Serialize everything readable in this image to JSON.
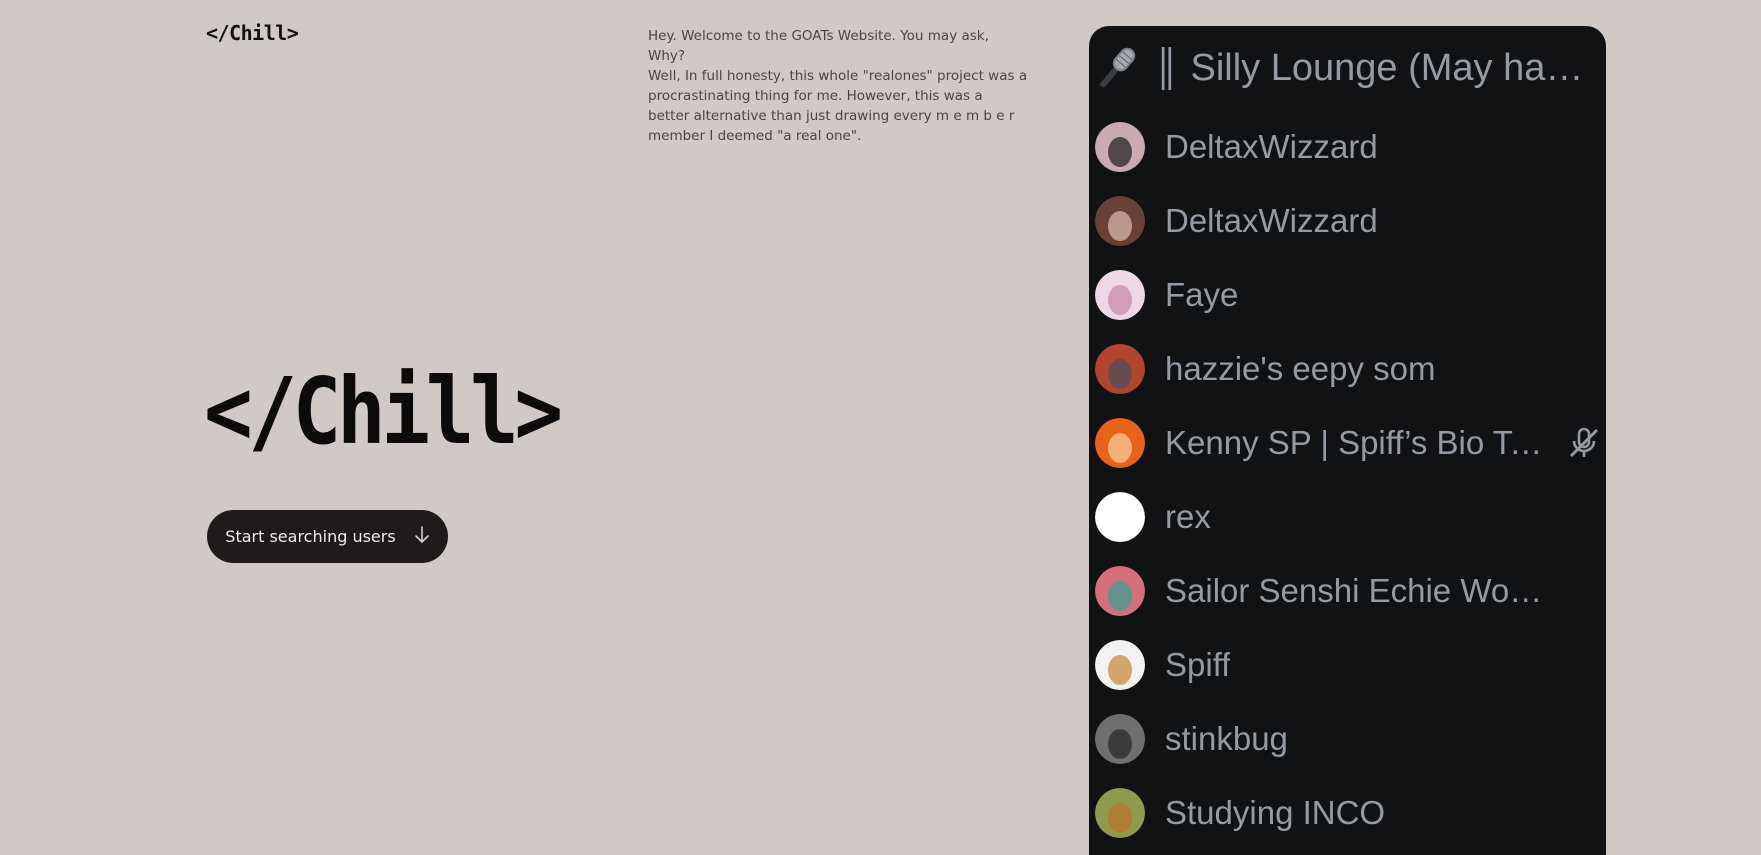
{
  "header": {
    "logo": "</Chill>"
  },
  "intro": {
    "lines": [
      "Hey. Welcome to the GOATs Website. You may ask,",
      "Why?",
      "Well, In full honesty, this whole \"realones\" project was a procrastinating thing for me. However, this was a better alternative than just drawing every m e m b e r member I deemed \"a real one\"."
    ]
  },
  "hero": {
    "title": "</Chill>",
    "cta_label": "Start searching users",
    "cta_icon": "arrow-down-icon"
  },
  "voice_channel": {
    "icon": "microphone-icon",
    "name": "║ Silly Lounge (May have L...",
    "members": [
      {
        "name": "DeltaxWizzard",
        "avatar_color": "#caa9b0",
        "avatar_accent": "#2a2628"
      },
      {
        "name": "DeltaxWizzard",
        "avatar_color": "#6a4034",
        "avatar_accent": "#d7b6a9"
      },
      {
        "name": "Faye",
        "avatar_color": "#efd8e6",
        "avatar_accent": "#c889a8"
      },
      {
        "name": "hazzie's eepy som",
        "avatar_color": "#b5442d",
        "avatar_accent": "#4c4f58"
      },
      {
        "name": "Kenny SP | Spiff’s Bio Te...",
        "avatar_color": "#e8621a",
        "avatar_accent": "#f5c99a",
        "muted": true
      },
      {
        "name": "rex",
        "avatar_color": "#ffffff",
        "avatar_accent": "#ffffff"
      },
      {
        "name": "Sailor Senshi Echie World",
        "avatar_color": "#d46f7b",
        "avatar_accent": "#3f9e93"
      },
      {
        "name": "Spiff",
        "avatar_color": "#f2f2f2",
        "avatar_accent": "#c88a35"
      },
      {
        "name": "stinkbug",
        "avatar_color": "#6f6f6f",
        "avatar_accent": "#2a2a2a"
      },
      {
        "name": "Studying INCO",
        "avatar_color": "#8f9a4c",
        "avatar_accent": "#c0702e"
      }
    ]
  },
  "colors": {
    "background": "#d0c9c5",
    "button": "#1e1b1a",
    "panel": "#111214",
    "panel_text": "#949ba4"
  }
}
